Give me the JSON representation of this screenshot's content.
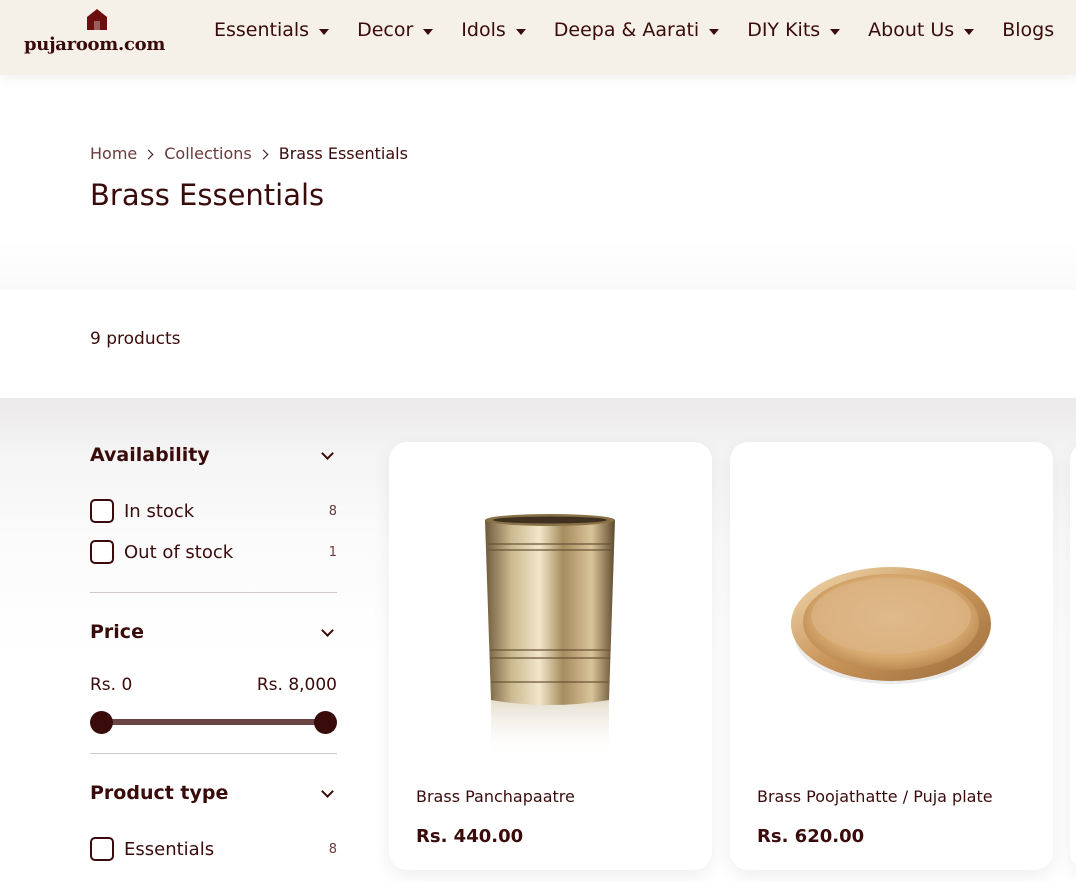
{
  "header": {
    "logo_text": "pujaroom.com",
    "nav": [
      {
        "label": "Essentials",
        "icon": "caret-down-icon"
      },
      {
        "label": "Decor",
        "icon": "caret-down-icon"
      },
      {
        "label": "Idols",
        "icon": "caret-down-icon"
      },
      {
        "label": "Deepa & Aarati",
        "icon": "caret-down-icon"
      },
      {
        "label": "DIY Kits",
        "icon": "caret-down-icon"
      },
      {
        "label": "About Us",
        "icon": "caret-down-icon"
      },
      {
        "label": "Blogs"
      }
    ]
  },
  "breadcrumb": {
    "home": "Home",
    "collections": "Collections",
    "current": "Brass Essentials"
  },
  "page_title": "Brass Essentials",
  "product_count": "9 products",
  "filters": {
    "availability": {
      "title": "Availability",
      "options": [
        {
          "label": "In stock",
          "count": "8"
        },
        {
          "label": "Out of stock",
          "count": "1"
        }
      ]
    },
    "price": {
      "title": "Price",
      "min_label": "Rs. 0",
      "max_label": "Rs. 8,000"
    },
    "product_type": {
      "title": "Product type",
      "options": [
        {
          "label": "Essentials",
          "count": "8"
        }
      ]
    }
  },
  "products": [
    {
      "name": "Brass Panchapaatre",
      "price": "Rs. 440.00"
    },
    {
      "name": "Brass Poojathatte / Puja plate",
      "price": "Rs. 620.00"
    }
  ],
  "colors": {
    "brand_maroon": "#3a0b0b",
    "header_bg": "#f5f1e8",
    "slider_track": "#6b4545",
    "brass": "#c9a468"
  }
}
